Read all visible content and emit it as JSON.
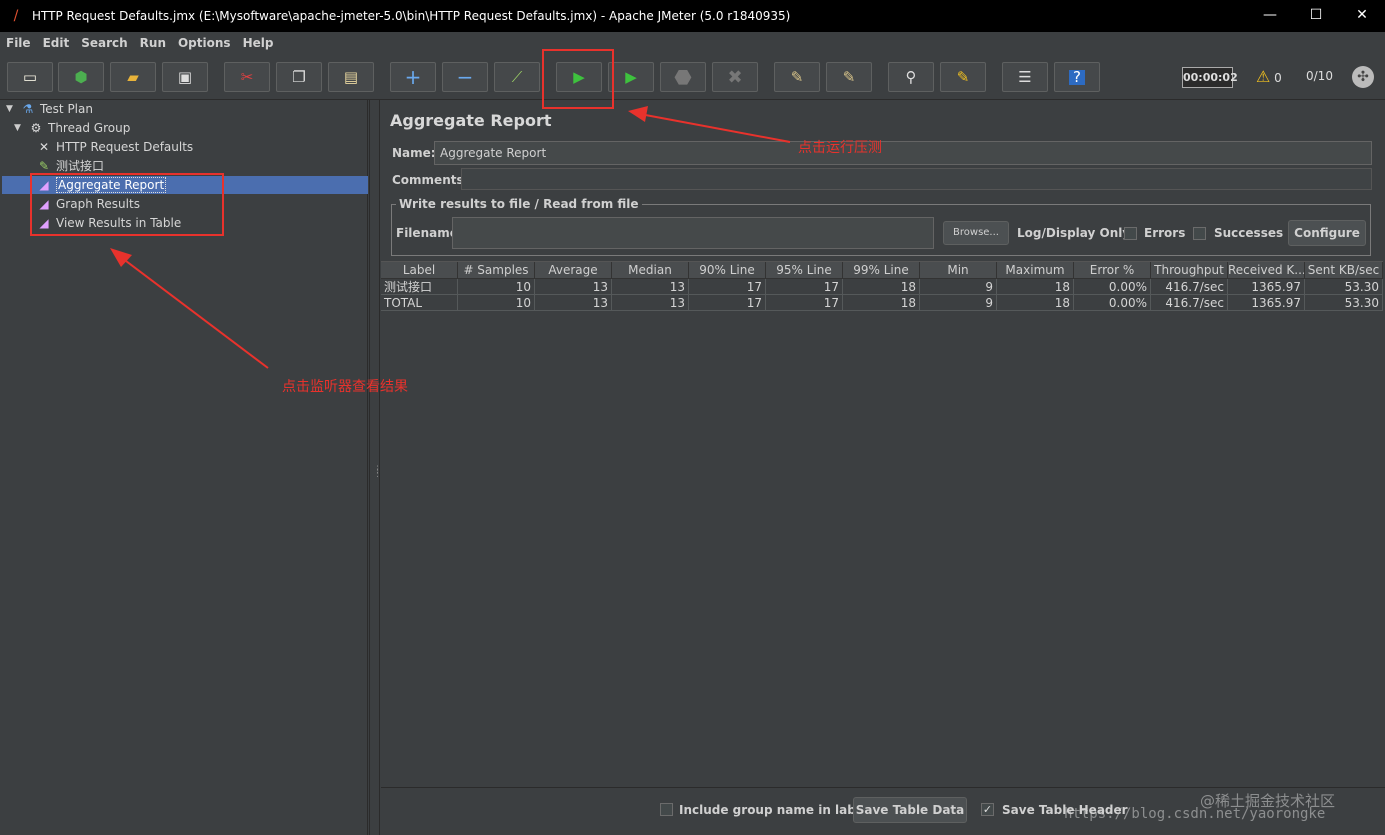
{
  "window": {
    "title": "HTTP Request Defaults.jmx (E:\\Mysoftware\\apache-jmeter-5.0\\bin\\HTTP Request Defaults.jmx) - Apache JMeter (5.0 r1840935)",
    "minimize": "—",
    "maximize": "☐",
    "close": "✕"
  },
  "menu": [
    "File",
    "Edit",
    "Search",
    "Run",
    "Options",
    "Help"
  ],
  "toolbar": {
    "timer": "00:00:02",
    "warning_count": "0",
    "threads": "0/10",
    "icons": [
      "new-icon",
      "templates-icon",
      "open-icon",
      "save-icon",
      "cut-icon",
      "copy-icon",
      "paste-icon",
      "expand-icon",
      "collapse-icon",
      "toggle-icon",
      "start-icon",
      "start-no-pause-icon",
      "stop-icon",
      "shutdown-icon",
      "clear-icon",
      "clear-all-icon",
      "search-icon",
      "reset-search-icon",
      "function-helper-icon",
      "help-icon"
    ]
  },
  "tree": {
    "items": [
      {
        "label": "Test Plan",
        "icon": "flask-icon"
      },
      {
        "label": "Thread Group",
        "icon": "gear-icon"
      },
      {
        "label": "HTTP Request Defaults",
        "icon": "wrench-icon"
      },
      {
        "label": "测试接口",
        "icon": "pen-icon"
      },
      {
        "label": "Aggregate Report",
        "icon": "chart-icon"
      },
      {
        "label": "Graph Results",
        "icon": "chart-icon"
      },
      {
        "label": "View Results in Table",
        "icon": "chart-icon"
      }
    ],
    "selected": "Aggregate Report"
  },
  "panel": {
    "title": "Aggregate Report",
    "name_label": "Name:",
    "name_value": "Aggregate Report",
    "comments_label": "Comments:",
    "file_group_title": "Write results to file / Read from file",
    "filename_label": "Filename",
    "browse_button": "Browse...",
    "log_display_label": "Log/Display Only:",
    "errors_label": "Errors",
    "successes_label": "Successes",
    "configure_button": "Configure"
  },
  "table": {
    "columns": [
      "Label",
      "# Samples",
      "Average",
      "Median",
      "90% Line",
      "95% Line",
      "99% Line",
      "Min",
      "Maximum",
      "Error %",
      "Throughput",
      "Received K...",
      "Sent KB/sec"
    ],
    "rows": [
      [
        "测试接口",
        "10",
        "13",
        "13",
        "17",
        "17",
        "18",
        "9",
        "18",
        "0.00%",
        "416.7/sec",
        "1365.97",
        "53.30"
      ],
      [
        "TOTAL",
        "10",
        "13",
        "13",
        "17",
        "17",
        "18",
        "9",
        "18",
        "0.00%",
        "416.7/sec",
        "1365.97",
        "53.30"
      ]
    ]
  },
  "bottom": {
    "include_group_label": "Include group name in label?",
    "save_table_data": "Save Table Data",
    "save_table_header": "Save Table Header"
  },
  "annotations": {
    "run_hint": "点击运行压测",
    "listener_hint": "点击监听器查看结果",
    "color": "#e8322c"
  },
  "watermark": {
    "line1": "@稀土掘金技术社区",
    "line2": "https://blog.csdn.net/yaorongke"
  }
}
